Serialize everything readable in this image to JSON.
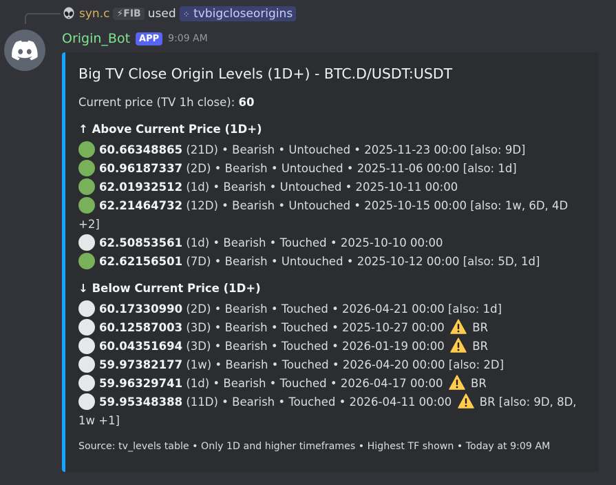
{
  "reply": {
    "username": "syn.c",
    "tag": "⚡FIB",
    "used_text": "used",
    "command": "tvbigcloseorigins"
  },
  "message": {
    "bot_name": "Origin_Bot",
    "badge": "APP",
    "time": "9:09 AM"
  },
  "embed": {
    "accent_color": "#16a4ff",
    "title": "Big TV Close Origin Levels (1D+) - BTC.D/USDT:USDT",
    "current_label": "Current price (TV 1h close): ",
    "current_value": "60",
    "above_header": "↑ Above Current Price (1D+)",
    "above": [
      {
        "status": "green",
        "price": "60.66348865",
        "rest": " (21D) • Bearish • Untouched • 2025-11-23 00:00 [also: 9D]"
      },
      {
        "status": "green",
        "price": "60.96187337",
        "rest": " (2D) • Bearish • Untouched • 2025-11-06 00:00 [also: 1d]"
      },
      {
        "status": "green",
        "price": "62.01932512",
        "rest": " (1d) • Bearish • Untouched • 2025-10-11 00:00"
      },
      {
        "status": "green",
        "price": "62.21464732",
        "rest": " (12D) • Bearish • Untouched • 2025-10-15 00:00 [also: 1w, 6D, 4D +2]"
      },
      {
        "status": "white",
        "price": "62.50853561",
        "rest": " (1d) • Bearish • Touched • 2025-10-10 00:00"
      },
      {
        "status": "green",
        "price": "62.62156501",
        "rest": " (7D) • Bearish • Untouched • 2025-10-12 00:00 [also: 5D, 1d]"
      }
    ],
    "below_header": "↓ Below Current Price (1D+)",
    "below": [
      {
        "status": "white",
        "price": "60.17330990",
        "rest": " (2D) • Bearish • Touched • 2026-04-21 00:00 [also: 1d]",
        "warn": false,
        "tail": ""
      },
      {
        "status": "white",
        "price": "60.12587003",
        "rest": " (3D) • Bearish • Touched • 2025-10-27 00:00",
        "warn": true,
        "tail": "BR"
      },
      {
        "status": "white",
        "price": "60.04351694",
        "rest": " (3D) • Bearish • Touched • 2026-01-19 00:00",
        "warn": true,
        "tail": "BR"
      },
      {
        "status": "white",
        "price": "59.97382177",
        "rest": " (1w) • Bearish • Touched • 2026-04-20 00:00 [also: 2D]",
        "warn": false,
        "tail": ""
      },
      {
        "status": "white",
        "price": "59.96329741",
        "rest": " (1d) • Bearish • Touched • 2026-04-17 00:00",
        "warn": true,
        "tail": "BR"
      },
      {
        "status": "white",
        "price": "59.95348388",
        "rest": " (11D) • Bearish • Touched • 2026-04-11 00:00",
        "warn": true,
        "tail": "BR [also: 9D, 8D, 1w +1]"
      }
    ],
    "footer": "Source: tv_levels table • Only 1D and higher timeframes • Highest TF shown  • Today at 9:09 AM"
  }
}
